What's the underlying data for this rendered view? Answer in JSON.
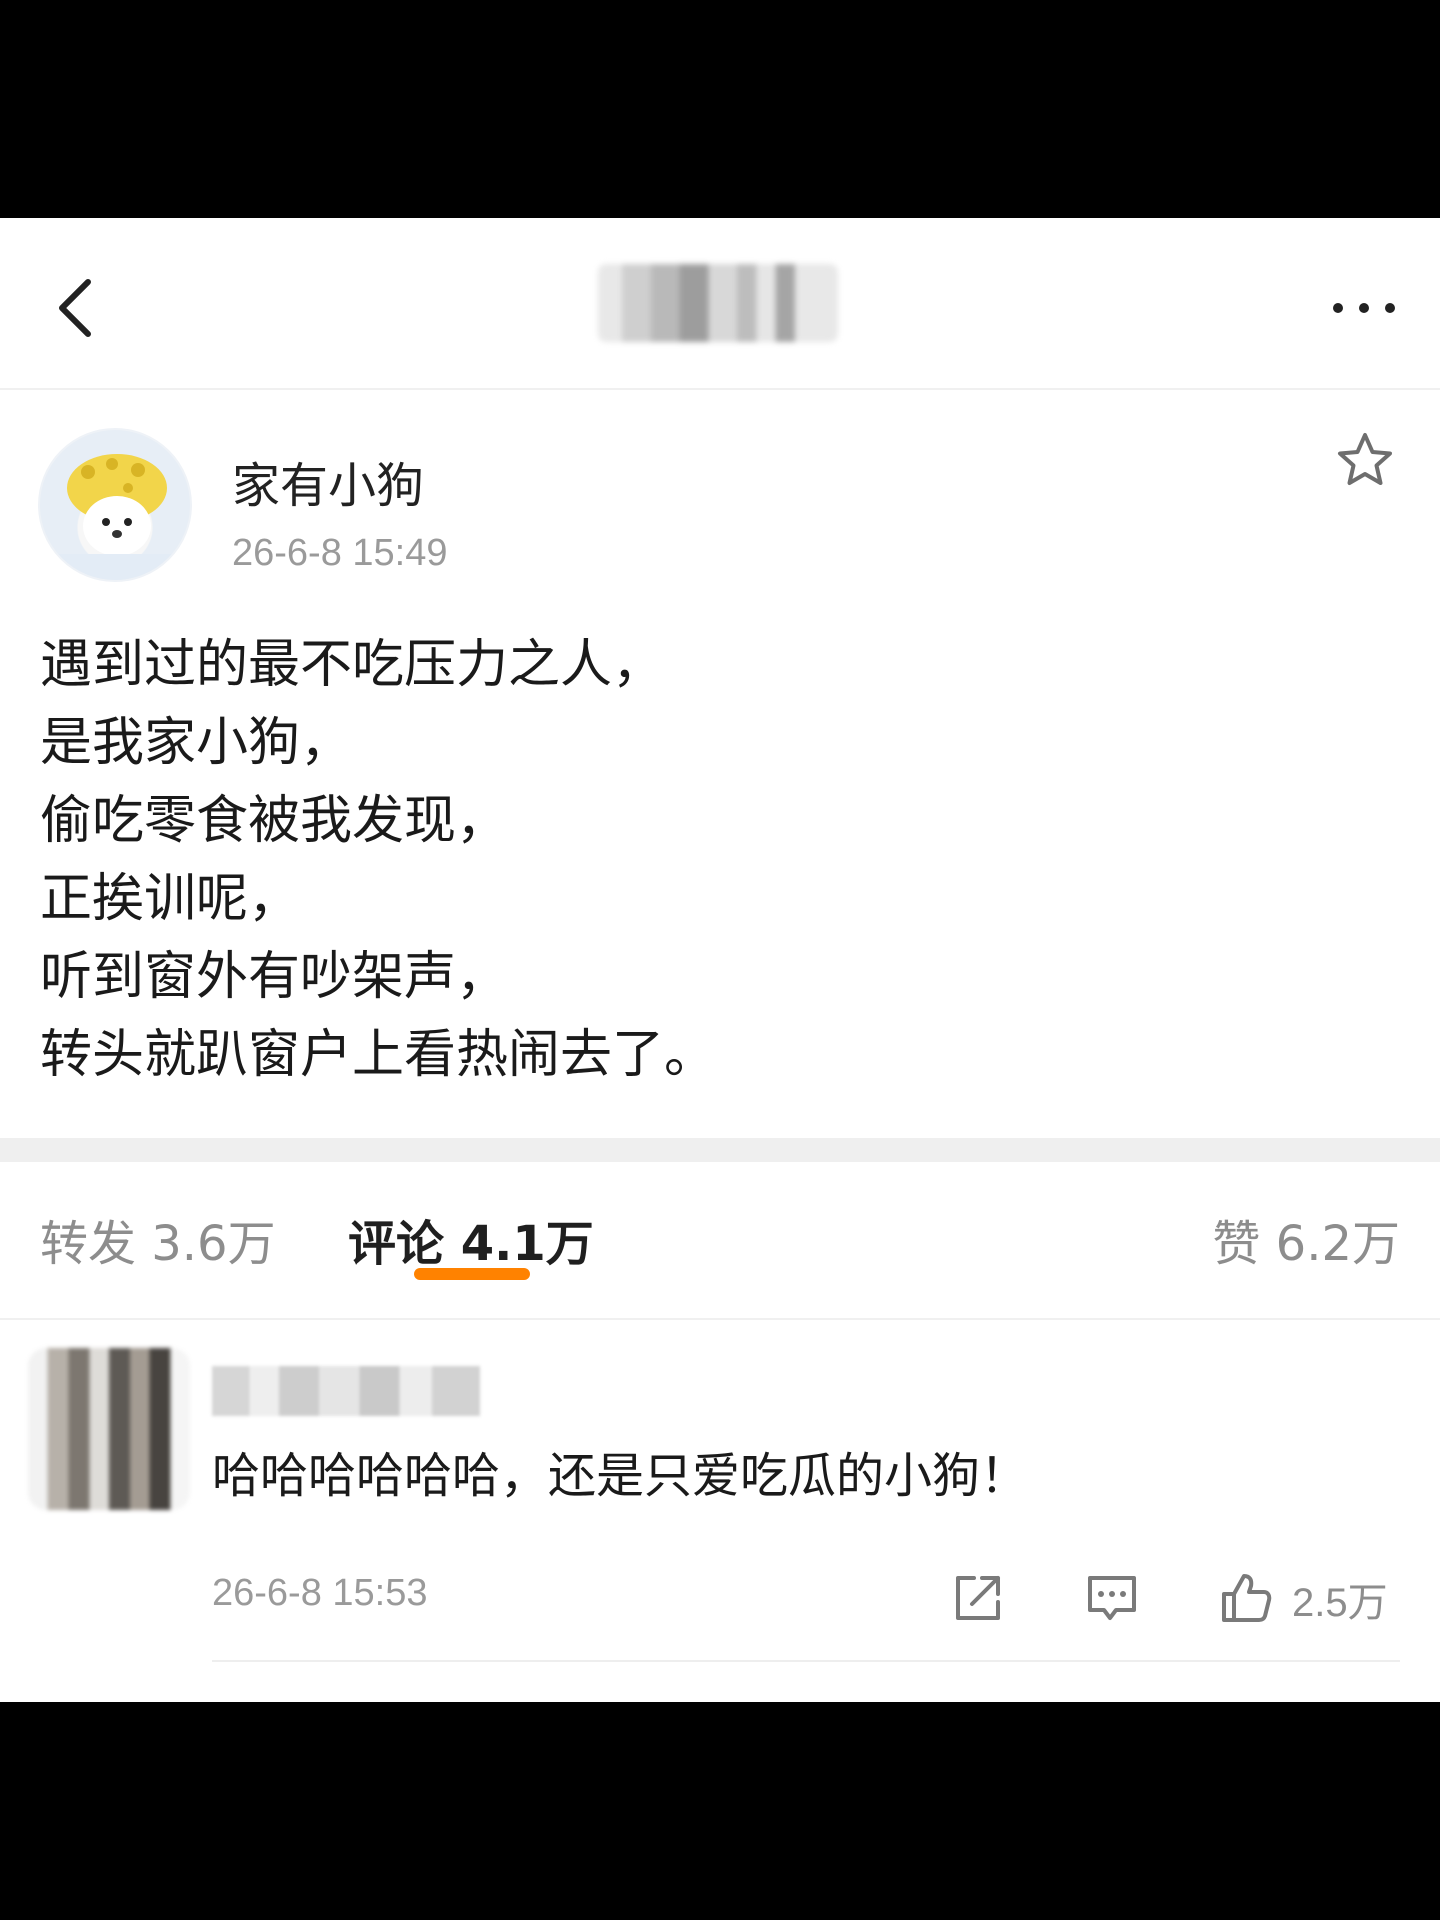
{
  "post": {
    "username": "家有小狗",
    "timestamp": "26-6-8 15:49",
    "lines": [
      "遇到过的最不吃压力之人，",
      "是我家小狗，",
      "偷吃零食被我发现，",
      "正挨训呢，",
      "听到窗外有吵架声，",
      "转头就趴窗户上看热闹去了。"
    ]
  },
  "tabs": {
    "repost": "转发 3.6万",
    "comment": "评论 4.1万",
    "like": "赞 6.2万"
  },
  "comment": {
    "text": "哈哈哈哈哈哈，还是只爱吃瓜的小狗！",
    "timestamp": "26-6-8 15:53",
    "like_count": "2.5万"
  },
  "icons": {
    "back": "chevron-left-icon",
    "more": "more-dots-icon",
    "favorite": "star-icon",
    "share": "share-icon",
    "reply": "comment-icon",
    "like": "thumbs-up-icon"
  },
  "colors": {
    "accent": "#ff8200"
  }
}
